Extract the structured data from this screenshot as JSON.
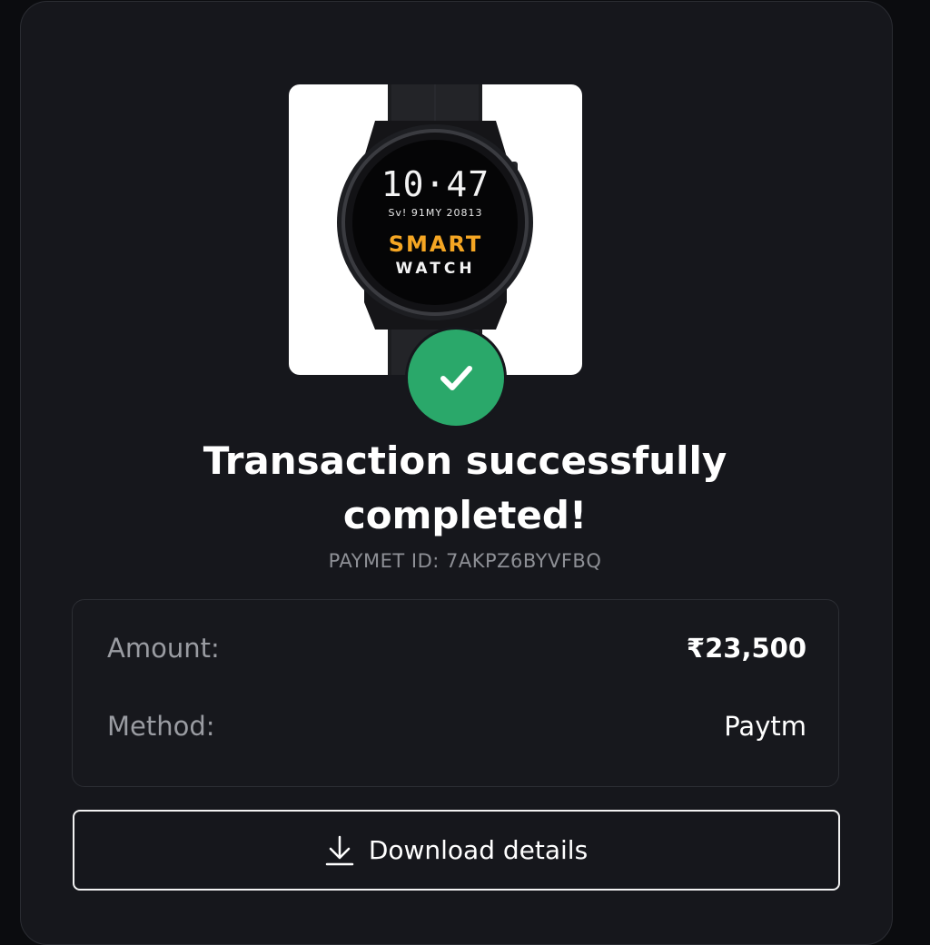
{
  "product": {
    "watch_time": "10·47",
    "watch_date": "Sv! 91MY 20813",
    "watch_brand_line1": "SMART",
    "watch_brand_line2": "WATCH"
  },
  "status": {
    "icon": "check-icon",
    "color": "#2aa86a",
    "title": "Transaction successfully completed!",
    "payment_id": "PAYMET ID: 7AKPZ6BYVFBQ"
  },
  "details": {
    "amount_label": "Amount:",
    "amount_value": "₹23,500",
    "method_label": "Method:",
    "method_value": "Paytm"
  },
  "actions": {
    "download_label": "Download details",
    "download_icon": "download-icon"
  }
}
